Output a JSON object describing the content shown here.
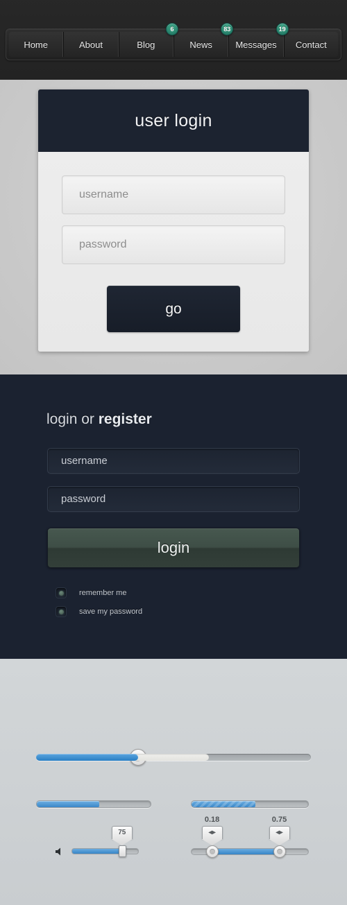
{
  "nav": {
    "items": [
      {
        "label": "Home",
        "badge": null
      },
      {
        "label": "About",
        "badge": null
      },
      {
        "label": "Blog",
        "badge": "6"
      },
      {
        "label": "News",
        "badge": "83"
      },
      {
        "label": "Messages",
        "badge": "19"
      },
      {
        "label": "Contact",
        "badge": null
      }
    ],
    "badge_color": "#2e8a72"
  },
  "login_card": {
    "title": "user login",
    "username": {
      "value": "",
      "placeholder": "username"
    },
    "password": {
      "value": "",
      "placeholder": "password"
    },
    "submit_label": "go",
    "header_color": "#1c2330",
    "button_color": "#1b2230"
  },
  "dark_panel": {
    "title_prefix": "login or ",
    "title_strong": "register",
    "username": {
      "value": "username",
      "placeholder": "username"
    },
    "password": {
      "value": "password",
      "placeholder": "password"
    },
    "login_label": "login",
    "login_button_color": "#3e4e46",
    "checkboxes": [
      {
        "label": "remember me",
        "checked": true
      },
      {
        "label": "save my password",
        "checked": true
      }
    ],
    "background_color": "#1b2230"
  },
  "sliders": {
    "accent_color": "#3785c6",
    "media_slider": {
      "name": "media-progress",
      "value_percent": 37,
      "buffer_percent": 63,
      "max": 100
    },
    "progress_bars": [
      {
        "name": "progress-solid",
        "value_percent": 55,
        "striped": false
      },
      {
        "name": "progress-striped",
        "value_percent": 55,
        "striped": true
      }
    ],
    "volume": {
      "icon": "speaker-icon",
      "value": "75",
      "value_percent": 75,
      "max": 100
    },
    "range": {
      "low_value": "0.18",
      "high_value": "0.75",
      "low_percent": 18,
      "high_percent": 75,
      "handle_glyph": "◂▸"
    }
  }
}
